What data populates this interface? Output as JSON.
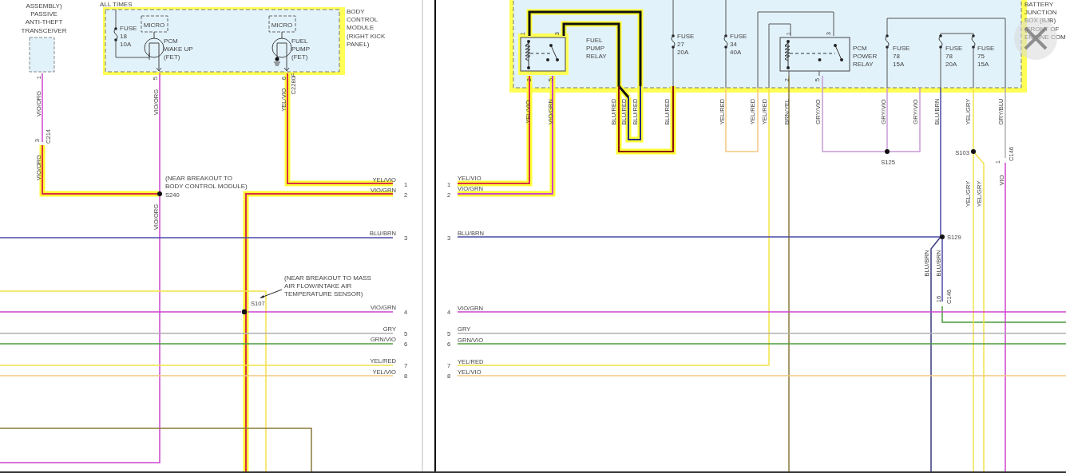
{
  "labels": [
    {
      "kind": "caption",
      "lines": [
        "ASSEMBLY)",
        "PASSIVE",
        "ANTI-THEFT",
        "TRANSCEIVER"
      ]
    },
    {
      "kind": "caption",
      "lines": [
        "ALL TIMES"
      ]
    },
    {
      "kind": "caption",
      "lines": [
        "BODY",
        "CONTROL",
        "MODULE",
        "(RIGHT KICK",
        "PANEL)"
      ]
    },
    {
      "kind": "caption",
      "lines": [
        "MICRO"
      ]
    },
    {
      "kind": "fuse",
      "lines": [
        "FUSE",
        "18",
        "10A"
      ]
    },
    {
      "kind": "caption",
      "lines": [
        "PCM",
        "WAKE UP",
        "(FET)"
      ]
    },
    {
      "kind": "caption",
      "lines": [
        "MICRO"
      ]
    },
    {
      "kind": "caption",
      "lines": [
        "FUEL",
        "PUMP",
        "(FET)"
      ]
    },
    {
      "kind": "pin",
      "lines": [
        "1"
      ]
    },
    {
      "kind": "wire",
      "lines": [
        "VIO/ORG"
      ]
    },
    {
      "kind": "connector",
      "lines": [
        "C214"
      ]
    },
    {
      "kind": "pin",
      "lines": [
        "3"
      ]
    },
    {
      "kind": "wire",
      "lines": [
        "VIO/ORG"
      ]
    },
    {
      "kind": "pin",
      "lines": [
        "5"
      ]
    },
    {
      "kind": "wire",
      "lines": [
        "VIO/ORG"
      ]
    },
    {
      "kind": "note",
      "lines": [
        "(NEAR BREAKOUT TO",
        "BODY CONTROL MODULE)"
      ]
    },
    {
      "kind": "splice",
      "lines": [
        "S240"
      ]
    },
    {
      "kind": "wire",
      "lines": [
        "VIO/ORG"
      ]
    },
    {
      "kind": "pin",
      "lines": [
        "6"
      ]
    },
    {
      "kind": "connector",
      "lines": [
        "C2280F"
      ]
    },
    {
      "kind": "wire",
      "lines": [
        "YEL/VIO"
      ]
    },
    {
      "kind": "wire",
      "lines": [
        "YEL/VIO"
      ]
    },
    {
      "kind": "circuit",
      "lines": [
        "1"
      ]
    },
    {
      "kind": "wire",
      "lines": [
        "VIO/GRN"
      ]
    },
    {
      "kind": "circuit",
      "lines": [
        "2"
      ]
    },
    {
      "kind": "wire",
      "lines": [
        "BLU/BRN"
      ]
    },
    {
      "kind": "circuit",
      "lines": [
        "3"
      ]
    },
    {
      "kind": "note",
      "lines": [
        "(NEAR BREAKOUT TO MASS",
        "AIR FLOW/INTAKE AIR",
        "TEMPERATURE SENSOR)"
      ]
    },
    {
      "kind": "splice",
      "lines": [
        "S107"
      ]
    },
    {
      "kind": "wire",
      "lines": [
        "VIO/GRN"
      ]
    },
    {
      "kind": "circuit",
      "lines": [
        "4"
      ]
    },
    {
      "kind": "wire",
      "lines": [
        "GRY"
      ]
    },
    {
      "kind": "circuit",
      "lines": [
        "5"
      ]
    },
    {
      "kind": "wire",
      "lines": [
        "GRN/VIO"
      ]
    },
    {
      "kind": "circuit",
      "lines": [
        "6"
      ]
    },
    {
      "kind": "wire",
      "lines": [
        "YEL/RED"
      ]
    },
    {
      "kind": "circuit",
      "lines": [
        "7"
      ]
    },
    {
      "kind": "wire",
      "lines": [
        "YEL/VIO"
      ]
    },
    {
      "kind": "circuit",
      "lines": [
        "8"
      ]
    },
    {
      "kind": "caption",
      "lines": [
        "BATTERY",
        "JUNCTION",
        "BOX (BJB)",
        "(FRONT OF",
        "ENGINE COM"
      ]
    },
    {
      "kind": "pin",
      "lines": [
        "1"
      ]
    },
    {
      "kind": "pin",
      "lines": [
        "3"
      ]
    },
    {
      "kind": "pin",
      "lines": [
        "2"
      ]
    },
    {
      "kind": "pin",
      "lines": [
        "5"
      ]
    },
    {
      "kind": "caption",
      "lines": [
        "FUEL",
        "PUMP",
        "RELAY"
      ]
    },
    {
      "kind": "fuse",
      "lines": [
        "FUSE",
        "27",
        "20A"
      ]
    },
    {
      "kind": "fuse",
      "lines": [
        "FUSE",
        "34",
        "40A"
      ]
    },
    {
      "kind": "pin",
      "lines": [
        "1"
      ]
    },
    {
      "kind": "pin",
      "lines": [
        "3"
      ]
    },
    {
      "kind": "pin",
      "lines": [
        "2"
      ]
    },
    {
      "kind": "pin",
      "lines": [
        "5"
      ]
    },
    {
      "kind": "caption",
      "lines": [
        "PCM",
        "POWER",
        "RELAY"
      ]
    },
    {
      "kind": "fuse",
      "lines": [
        "FUSE",
        "78",
        "15A"
      ]
    },
    {
      "kind": "fuse",
      "lines": [
        "FUSE",
        "78",
        "20A"
      ]
    },
    {
      "kind": "fuse",
      "lines": [
        "FUSE",
        "75",
        "15A"
      ]
    },
    {
      "kind": "wire",
      "lines": [
        "YEL/VIO"
      ]
    },
    {
      "kind": "wire",
      "lines": [
        "VIO/GRN"
      ]
    },
    {
      "kind": "wire",
      "lines": [
        "BLU/RED"
      ]
    },
    {
      "kind": "wire",
      "lines": [
        "BLU/RED"
      ]
    },
    {
      "kind": "wire",
      "lines": [
        "BLU/RED"
      ]
    },
    {
      "kind": "wire",
      "lines": [
        "BLU/RED"
      ]
    },
    {
      "kind": "wire",
      "lines": [
        "YEL/RED"
      ]
    },
    {
      "kind": "wire",
      "lines": [
        "YEL/RED"
      ]
    },
    {
      "kind": "wire",
      "lines": [
        "YEL/RED"
      ]
    },
    {
      "kind": "wire",
      "lines": [
        "BRN/YEL"
      ]
    },
    {
      "kind": "wire",
      "lines": [
        "GRY/VIO"
      ]
    },
    {
      "kind": "wire",
      "lines": [
        "GRY/VIO"
      ]
    },
    {
      "kind": "wire",
      "lines": [
        "GRY/VIO"
      ]
    },
    {
      "kind": "wire",
      "lines": [
        "BLU/BRN"
      ]
    },
    {
      "kind": "wire",
      "lines": [
        "YEL/GRY"
      ]
    },
    {
      "kind": "wire",
      "lines": [
        "GRY/BLU"
      ]
    },
    {
      "kind": "splice",
      "lines": [
        "S125"
      ]
    },
    {
      "kind": "splice",
      "lines": [
        "S103"
      ]
    },
    {
      "kind": "pin",
      "lines": [
        "1"
      ]
    },
    {
      "kind": "connector",
      "lines": [
        "C146"
      ]
    },
    {
      "kind": "wire",
      "lines": [
        "VIO"
      ]
    },
    {
      "kind": "wire",
      "lines": [
        "YEL/GRY"
      ]
    },
    {
      "kind": "wire",
      "lines": [
        "YEL/GRY"
      ]
    },
    {
      "kind": "circuit",
      "lines": [
        "1"
      ]
    },
    {
      "kind": "wire",
      "lines": [
        "YEL/VIO"
      ]
    },
    {
      "kind": "circuit",
      "lines": [
        "2"
      ]
    },
    {
      "kind": "wire",
      "lines": [
        "VIO/GRN"
      ]
    },
    {
      "kind": "circuit",
      "lines": [
        "3"
      ]
    },
    {
      "kind": "wire",
      "lines": [
        "BLU/BRN"
      ]
    },
    {
      "kind": "splice",
      "lines": [
        "S129"
      ]
    },
    {
      "kind": "wire",
      "lines": [
        "BLU/BRN"
      ]
    },
    {
      "kind": "wire",
      "lines": [
        "BLU/BRN"
      ]
    },
    {
      "kind": "pin",
      "lines": [
        "16"
      ]
    },
    {
      "kind": "connector",
      "lines": [
        "C146"
      ]
    },
    {
      "kind": "circuit",
      "lines": [
        "4"
      ]
    },
    {
      "kind": "wire",
      "lines": [
        "VIO/GRN"
      ]
    },
    {
      "kind": "circuit",
      "lines": [
        "5"
      ]
    },
    {
      "kind": "wire",
      "lines": [
        "GRY"
      ]
    },
    {
      "kind": "circuit",
      "lines": [
        "6"
      ]
    },
    {
      "kind": "wire",
      "lines": [
        "GRN/VIO"
      ]
    },
    {
      "kind": "circuit",
      "lines": [
        "7"
      ]
    },
    {
      "kind": "wire",
      "lines": [
        "YEL/RED"
      ]
    },
    {
      "kind": "circuit",
      "lines": [
        "8"
      ]
    },
    {
      "kind": "wire",
      "lines": [
        "YEL/VIO"
      ]
    }
  ]
}
